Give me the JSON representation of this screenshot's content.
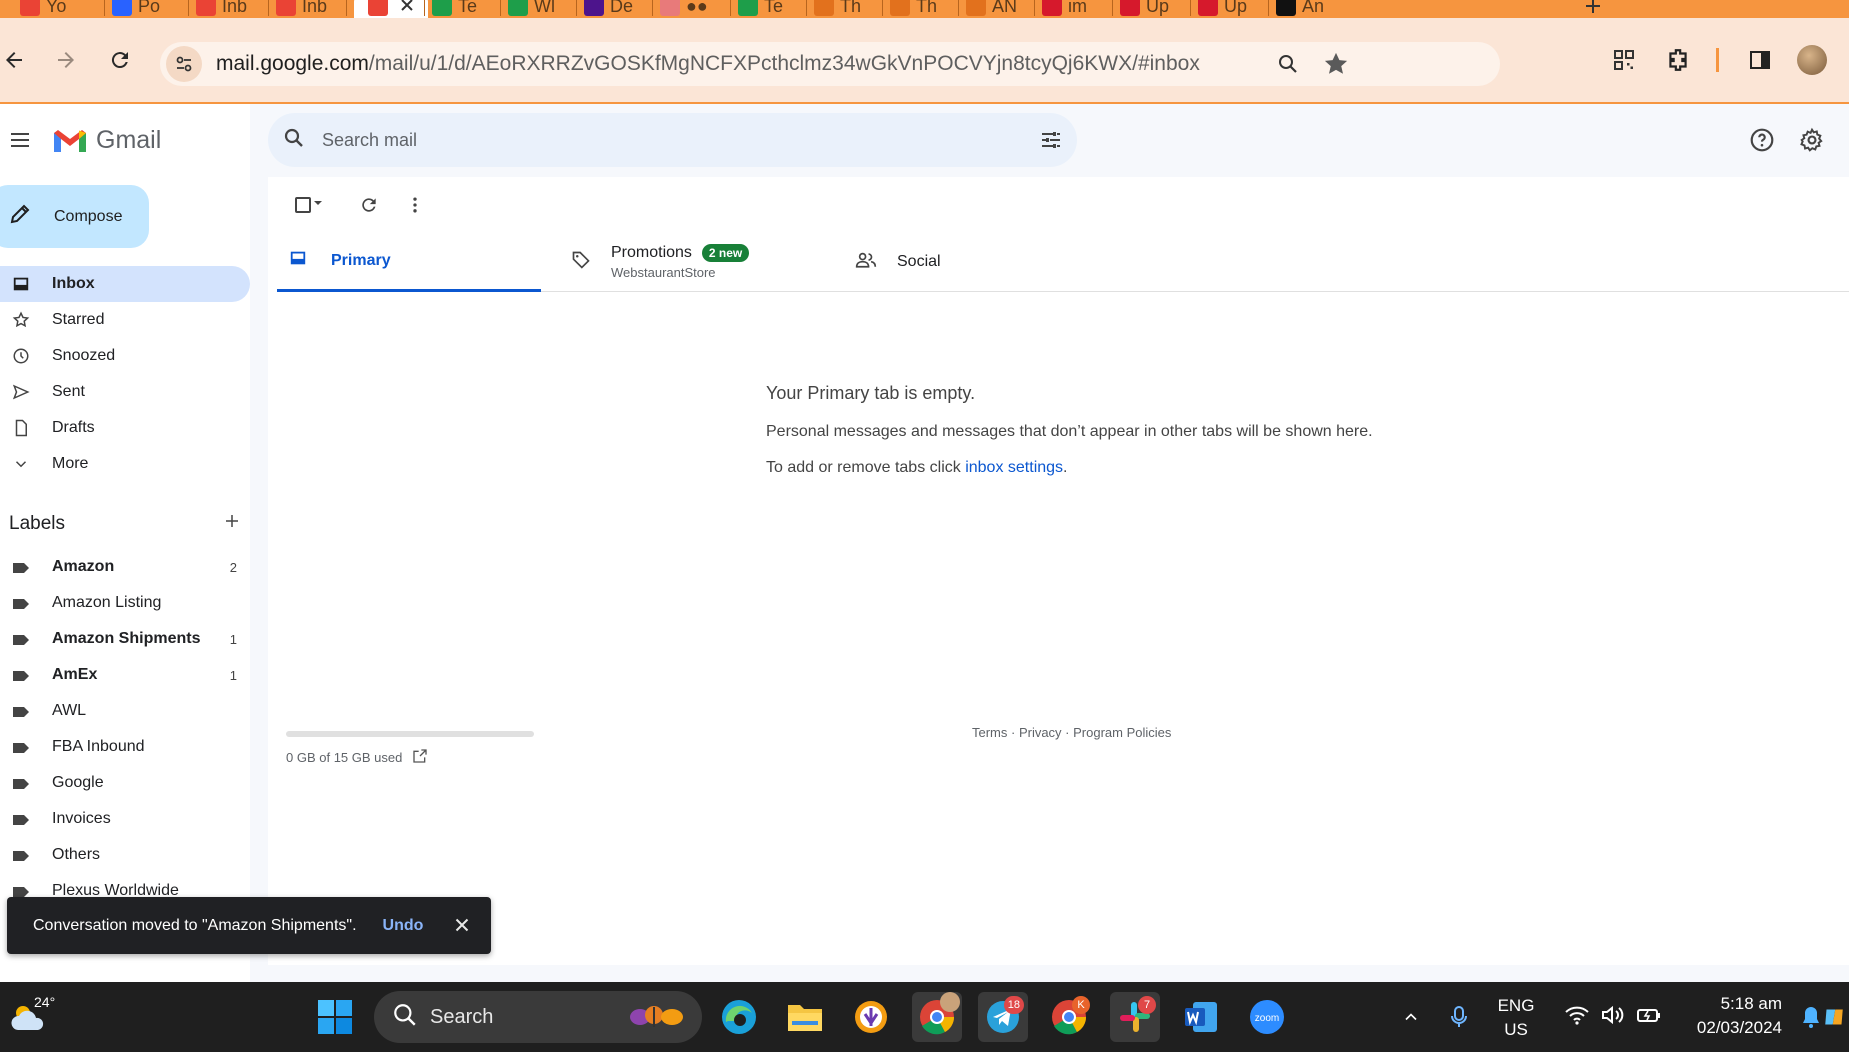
{
  "browser": {
    "tabs": [
      {
        "label": "Yo",
        "favicon": "gmail-icon"
      },
      {
        "label": "Po",
        "favicon": "2m-icon"
      },
      {
        "label": "Inb",
        "favicon": "gmail-icon"
      },
      {
        "label": "Inb",
        "favicon": "gmail-icon"
      },
      {
        "label": "",
        "favicon": "gmail-icon",
        "active": true
      },
      {
        "label": "Te",
        "favicon": "plus-sheet-icon"
      },
      {
        "label": "Wl",
        "favicon": "plus-sheet-icon"
      },
      {
        "label": "De",
        "favicon": "fedex-icon"
      },
      {
        "label": "●●",
        "favicon": "dots-icon"
      },
      {
        "label": "Te",
        "favicon": "plus-sheet-icon"
      },
      {
        "label": "Th",
        "favicon": "pencil-icon"
      },
      {
        "label": "Th",
        "favicon": "pencil-icon"
      },
      {
        "label": "AN",
        "favicon": "pencil-icon"
      },
      {
        "label": "im",
        "favicon": "pin-icon"
      },
      {
        "label": "Up",
        "favicon": "pin-icon"
      },
      {
        "label": "Up",
        "favicon": "pin-icon"
      },
      {
        "label": "An",
        "favicon": "amazon-icon"
      }
    ],
    "url_host": "mail.google.com",
    "url_path": "/mail/u/1/d/AEoRXRRZvGOSKfMgNCFXPcthclmz34wGkVnPOCVYjn8tcyQj6KWX/#inbox",
    "accent": "#f6953f"
  },
  "gmail": {
    "logo_text": "Gmail",
    "search_placeholder": "Search mail",
    "compose_label": "Compose",
    "nav": [
      {
        "label": "Inbox",
        "icon": "inbox-icon",
        "active": true
      },
      {
        "label": "Starred",
        "icon": "star-icon"
      },
      {
        "label": "Snoozed",
        "icon": "clock-icon"
      },
      {
        "label": "Sent",
        "icon": "send-icon"
      },
      {
        "label": "Drafts",
        "icon": "draft-icon"
      },
      {
        "label": "More",
        "icon": "chevron-down-icon"
      }
    ],
    "labels_title": "Labels",
    "labels": [
      {
        "label": "Amazon",
        "count": "2",
        "bold": true
      },
      {
        "label": "Amazon Listing",
        "count": "",
        "bold": false
      },
      {
        "label": "Amazon Shipments",
        "count": "1",
        "bold": true
      },
      {
        "label": "AmEx",
        "count": "1",
        "bold": true
      },
      {
        "label": "AWL",
        "count": "",
        "bold": false
      },
      {
        "label": "FBA Inbound",
        "count": "",
        "bold": false
      },
      {
        "label": "Google",
        "count": "",
        "bold": false
      },
      {
        "label": "Invoices",
        "count": "",
        "bold": false
      },
      {
        "label": "Others",
        "count": "",
        "bold": false
      },
      {
        "label": "Plexus Worldwide",
        "count": "",
        "bold": false
      }
    ],
    "tabs": {
      "primary": "Primary",
      "promotions": "Promotions",
      "promotions_badge": "2 new",
      "promotions_sub": "WebstaurantStore",
      "social": "Social"
    },
    "empty": {
      "title": "Your Primary tab is empty.",
      "line1": "Personal messages and messages that don’t appear in other tabs will be shown here.",
      "line2_prefix": "To add or remove tabs click ",
      "line2_link": "inbox settings",
      "line2_suffix": "."
    },
    "storage": "0 GB of 15 GB used",
    "footer": "Terms · Privacy · Program Policies",
    "snackbar": {
      "message": "Conversation moved to \"Amazon Shipments\".",
      "undo": "Undo"
    }
  },
  "taskbar": {
    "weather_temp": "24°",
    "search_label": "Search",
    "telegram_badge": "18",
    "chrome_badge": "K",
    "slack_badge": "7",
    "language_line1": "ENG",
    "language_line2": "US",
    "time": "5:18 am",
    "date": "02/03/2024"
  }
}
